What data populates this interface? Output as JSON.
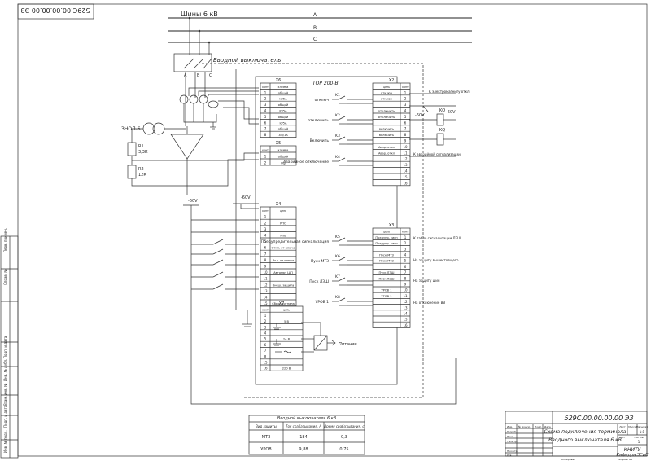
{
  "doc_number_rotated": "529С.00.00.00.00 ЭЗ",
  "bus_title": "Шины 6 кВ",
  "phases": [
    "A",
    "B",
    "C"
  ],
  "breaker_label": "Вводной выключатель",
  "breaker_phases": [
    "A",
    "B",
    "C"
  ],
  "vt_label": "ЗНОЛ-6",
  "r1": {
    "name": "R1",
    "value": "3,3К"
  },
  "r2": {
    "name": "R2",
    "value": "12К"
  },
  "device_title": "ТОР 200-В",
  "minus_label": "-60V",
  "x6": {
    "name": "X6",
    "head": [
      "конт",
      "клемма"
    ],
    "rows": [
      [
        "1",
        "общий"
      ],
      [
        "2",
        "Ia/5A"
      ],
      [
        "3",
        "общий"
      ],
      [
        "4",
        "Ib/5A"
      ],
      [
        "5",
        "общий"
      ],
      [
        "6",
        "Ic/5A"
      ],
      [
        "7",
        "общий"
      ],
      [
        "8",
        "3Io/1A"
      ]
    ]
  },
  "x5": {
    "name": "X5",
    "head": [
      "конт",
      "клемма"
    ],
    "rows": [
      [
        "1",
        "общий"
      ],
      [
        "2",
        "Uф"
      ]
    ]
  },
  "x2": {
    "name": "X2",
    "head": [
      "цепь",
      "конт"
    ],
    "rows": [
      [
        "отключ",
        "1"
      ],
      [
        "отключ",
        "2"
      ],
      [
        "",
        "3"
      ],
      [
        "отключить",
        "4"
      ],
      [
        "отключить",
        "5"
      ],
      [
        "",
        "6"
      ],
      [
        "включить",
        "7"
      ],
      [
        "включить",
        "8"
      ],
      [
        "",
        "9"
      ],
      [
        "Авар. откл",
        "10"
      ],
      [
        "Авар. откл",
        "11"
      ],
      [
        "",
        "12"
      ],
      [
        "",
        "13"
      ],
      [
        "",
        "14"
      ],
      [
        "",
        "15"
      ],
      [
        "",
        "16"
      ]
    ]
  },
  "x4": {
    "name": "X4",
    "head": [
      "конт",
      "цепь"
    ],
    "rows": [
      [
        "1",
        ""
      ],
      [
        "2",
        "РПО"
      ],
      [
        "3",
        ""
      ],
      [
        "4",
        "РПВ"
      ],
      [
        "5",
        ""
      ],
      [
        "6",
        "Откл. от ключа"
      ],
      [
        "7",
        ""
      ],
      [
        "8",
        "Вкл. от ключа"
      ],
      [
        "9",
        ""
      ],
      [
        "10",
        "Автомат ШП"
      ],
      [
        "11",
        ""
      ],
      [
        "12",
        "Внеш. защита"
      ],
      [
        "13",
        ""
      ],
      [
        "14",
        ""
      ],
      [
        "15",
        "Сброс сигнала"
      ],
      [
        "16",
        ""
      ]
    ]
  },
  "x3": {
    "name": "X3",
    "head": [
      "цепь",
      "конт"
    ],
    "rows": [
      [
        "Предупр. сигн",
        "1"
      ],
      [
        "Предупр. сигн",
        "2"
      ],
      [
        "",
        "3"
      ],
      [
        "Пуск МТЗ",
        "4"
      ],
      [
        "Пуск МТЗ",
        "5"
      ],
      [
        "",
        "6"
      ],
      [
        "Пуск ЛЗШ",
        "7"
      ],
      [
        "Пуск ЛЗШ",
        "8"
      ],
      [
        "",
        "9"
      ],
      [
        "УРОВ 1",
        "10"
      ],
      [
        "УРОВ 1",
        "11"
      ],
      [
        "",
        "12"
      ],
      [
        "",
        "13"
      ],
      [
        "",
        "14"
      ],
      [
        "",
        "15"
      ],
      [
        "",
        "16"
      ]
    ]
  },
  "x7": {
    "name": "X7",
    "head": [
      "конт",
      "цепь"
    ],
    "rows": [
      [
        "1",
        ""
      ],
      [
        "2",
        "5 В"
      ],
      [
        "3",
        ""
      ],
      [
        "4",
        ""
      ],
      [
        "5",
        "24 В"
      ],
      [
        "6",
        ""
      ],
      [
        "7",
        ""
      ],
      [
        "8",
        ""
      ],
      [
        "15",
        ""
      ],
      [
        "16",
        "220 В"
      ]
    ]
  },
  "relays_left": [
    {
      "k": "K1",
      "label": "отключ"
    },
    {
      "k": "K2",
      "label": "отключить"
    },
    {
      "k": "K3",
      "label": "Включить"
    },
    {
      "k": "K4",
      "label": "Аварийное отключение"
    }
  ],
  "relays_right": [
    {
      "k": "K5",
      "label": "Предупредительная сигнализация"
    },
    {
      "k": "K6",
      "label": "Пуск МТЗ"
    },
    {
      "k": "K7",
      "label": "Пуск ЛЗШ"
    },
    {
      "k": "K8",
      "label": "УРОВ 1"
    }
  ],
  "coil_labels": [
    "KQ",
    "KQ"
  ],
  "out_notes": [
    "К электромагниту откл",
    "К аварийной сигнализации",
    "К табло сигнализации ЛЗШ",
    "На защиту вышестоящего",
    "На защиту шин",
    "На отключение ВВ"
  ],
  "power_label": "Питание",
  "volt_labels": [
    "5 В",
    "24 В",
    "220 В"
  ],
  "settings_table": {
    "title": "Вводной выключатель 6 кВ",
    "columns": [
      "Вид защиты",
      "Ток срабатывания, А",
      "Время срабатывания, с"
    ],
    "rows": [
      [
        "МТЗ",
        "184",
        "0,3"
      ],
      [
        "УРОВ",
        "9,88",
        "0,75"
      ]
    ]
  },
  "title_block": {
    "doc_number": "529С.00.00.00.00 ЭЗ",
    "name_line1": "Схема подключения терминала",
    "name_line2": "Вводного выключателя 6 кВ",
    "org_line1": "КНИТУ",
    "org_line2": "Кафедра ЭСиС",
    "sheet_label": "Лист",
    "sheets_label": "Листов",
    "mass_label": "Масса",
    "scale_label": "Масштаб",
    "scale": "1:1",
    "sheets": "1",
    "roles": [
      "Изм.",
      "Лист",
      "№ докум.",
      "Подп.",
      "Дата",
      "Разраб.",
      "Пров.",
      "Т.контр.",
      "Н.контр.",
      "Утв."
    ],
    "copied": "Копировал",
    "format": "Формат  А1"
  },
  "left_strip": [
    "Перв. примен.",
    "Справ. №",
    "Подп. и дата",
    "Инв. № дубл.",
    "Взам. инв. №",
    "Подп. и дата",
    "Инв. № подл."
  ]
}
